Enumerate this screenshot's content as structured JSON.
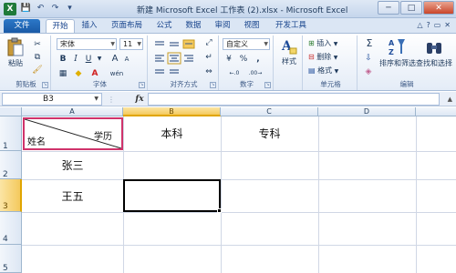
{
  "window": {
    "title": "新建 Microsoft Excel 工作表 (2).xlsx - Microsoft Excel",
    "app_icon": "X",
    "controls": {
      "minimize": "─",
      "maximize": "□",
      "close": "✕"
    }
  },
  "qat": {
    "save_icon": "💾",
    "undo_icon": "↶",
    "redo_icon": "↷",
    "customize_icon": "▾"
  },
  "tabs": [
    {
      "label": "文件"
    },
    {
      "label": "开始"
    },
    {
      "label": "插入"
    },
    {
      "label": "页面布局"
    },
    {
      "label": "公式"
    },
    {
      "label": "数据"
    },
    {
      "label": "审阅"
    },
    {
      "label": "视图"
    },
    {
      "label": "开发工具"
    }
  ],
  "tab_right": {
    "help": "?",
    "minimize_ribbon": "△",
    "restore": "▭",
    "close": "✕"
  },
  "ribbon": {
    "clipboard": {
      "paste_label": "粘贴",
      "group_label": "剪贴板"
    },
    "font": {
      "font_name": "宋体",
      "font_size": "11",
      "bold": "B",
      "italic": "I",
      "underline": "U",
      "grow": "A",
      "shrink": "A",
      "wen": "wén",
      "group_label": "字体"
    },
    "alignment": {
      "group_label": "对齐方式"
    },
    "number": {
      "format": "自定义",
      "currency": "¥",
      "percent": "%",
      "comma": ",",
      "group_label": "数字"
    },
    "styles": {
      "label": "样式"
    },
    "cells": {
      "insert": "插入",
      "delete": "删除",
      "format": "格式",
      "group_label": "单元格"
    },
    "editing": {
      "sigma": "Σ",
      "sort_filter": "排序和筛选",
      "find_select": "查找和选择",
      "group_label": "编辑"
    }
  },
  "formula_bar": {
    "name_box": "B3",
    "fx": "fx",
    "value": ""
  },
  "grid": {
    "columns": [
      "A",
      "B",
      "C",
      "D"
    ],
    "selected_column": "B",
    "rows": [
      "1",
      "2",
      "3",
      "4",
      "5"
    ],
    "selected_row": "3",
    "cells": {
      "A1_top": "学历",
      "A1_bottom": "姓名",
      "B1": "本科",
      "C1": "专科",
      "A2": "张三",
      "A3": "王五"
    },
    "active_cell": "B3",
    "accent_colors": {
      "highlight_border": "#d0336b",
      "selection": "#f4c95d"
    }
  }
}
